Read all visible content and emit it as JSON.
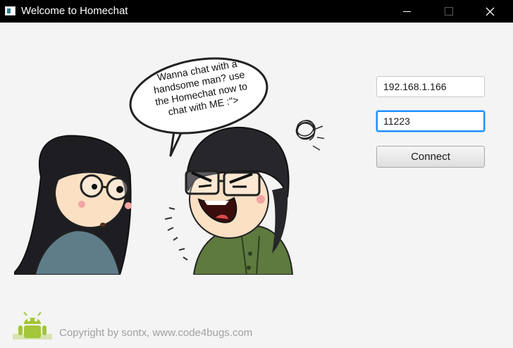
{
  "window": {
    "title": "Welcome to Homechat"
  },
  "illustration": {
    "speech_lines": [
      "Wanna chat with a",
      "handsome man? use",
      "the Homechat now to",
      "chat with ME :\">"
    ]
  },
  "form": {
    "host_value": "192.168.1.166",
    "port_value": "11223",
    "connect_label": "Connect"
  },
  "footer": {
    "copyright": "Copyright by sontx, www.code4bugs.com",
    "logo_icon": "android-icon"
  },
  "colors": {
    "titlebar": "#000000",
    "background": "#f4f4f4",
    "focus_ring": "#1e90ff",
    "android_green": "#a4c639"
  }
}
